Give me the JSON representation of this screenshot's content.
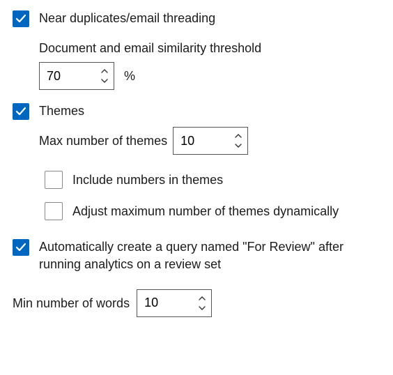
{
  "nearDup": {
    "label": "Near duplicates/email threading",
    "thresholdLabel": "Document and email similarity threshold",
    "thresholdValue": "70",
    "thresholdUnit": "%"
  },
  "themes": {
    "label": "Themes",
    "maxLabel": "Max number of themes",
    "maxValue": "10",
    "includeNumbersLabel": "Include numbers in themes",
    "adjustDynLabel": "Adjust maximum number of themes dynamically"
  },
  "autoQuery": {
    "label": "Automatically create a query named \"For Review\" after running analytics on a review set"
  },
  "minWords": {
    "label": "Min number of words",
    "value": "10"
  }
}
